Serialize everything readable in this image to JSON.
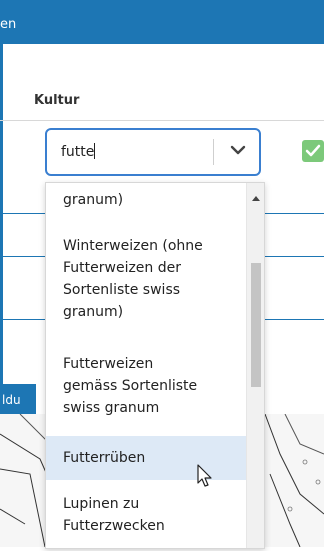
{
  "header": {
    "title_fragment": "en"
  },
  "form": {
    "kultur_label": "Kultur",
    "kultur_input_value": "futte"
  },
  "bottom_tab": {
    "label_fragment": "ldu"
  },
  "dropdown": {
    "options": [
      "granum)",
      "Winterweizen (ohne\nFutterweizen der\nSortenliste swiss\ngranum)",
      "Futterweizen\ngemäss Sortenliste\nswiss granum",
      "Futterrüben",
      "Lupinen zu\nFutterzwecken"
    ],
    "highlighted_option": "Futterrüben"
  },
  "colors": {
    "header_bg": "#1d76b4",
    "input_border": "#3a7fd0",
    "highlight_bg": "#dde9f6",
    "success": "#7cc97a"
  },
  "icons": [
    "chevron-down-icon",
    "check-icon",
    "scroll-up-icon",
    "mouse-cursor-icon"
  ]
}
